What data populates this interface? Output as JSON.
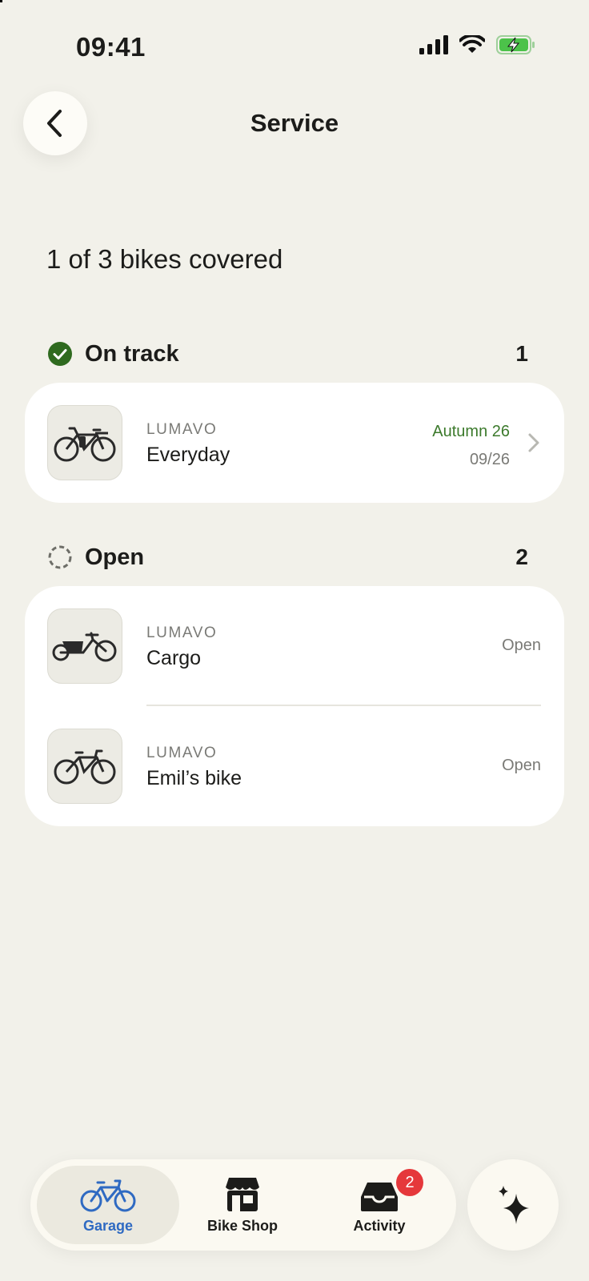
{
  "status_bar": {
    "time": "09:41"
  },
  "header": {
    "title": "Service"
  },
  "summary": "1 of 3 bikes covered",
  "sections": {
    "on_track": {
      "label": "On track",
      "count": "1",
      "items": [
        {
          "brand": "LUMAVO",
          "name": "Everyday",
          "season": "Autumn 26",
          "date": "09/26",
          "icon": "city-ebike-icon"
        }
      ]
    },
    "open": {
      "label": "Open",
      "count": "2",
      "items": [
        {
          "brand": "LUMAVO",
          "name": "Cargo",
          "status": "Open",
          "icon": "cargo-bike-icon"
        },
        {
          "brand": "LUMAVO",
          "name": "Emil’s bike",
          "status": "Open",
          "icon": "kids-bike-icon"
        }
      ]
    }
  },
  "tab_bar": {
    "tabs": [
      {
        "label": "Garage",
        "icon": "bicycle-icon",
        "active": true
      },
      {
        "label": "Bike Shop",
        "icon": "shop-icon"
      },
      {
        "label": "Activity",
        "icon": "inbox-icon",
        "badge": "2"
      }
    ]
  },
  "colors": {
    "accent": "#2f6ac2",
    "success": "#3c7a2c",
    "badge": "#e5383b",
    "background": "#f2f1ea"
  }
}
